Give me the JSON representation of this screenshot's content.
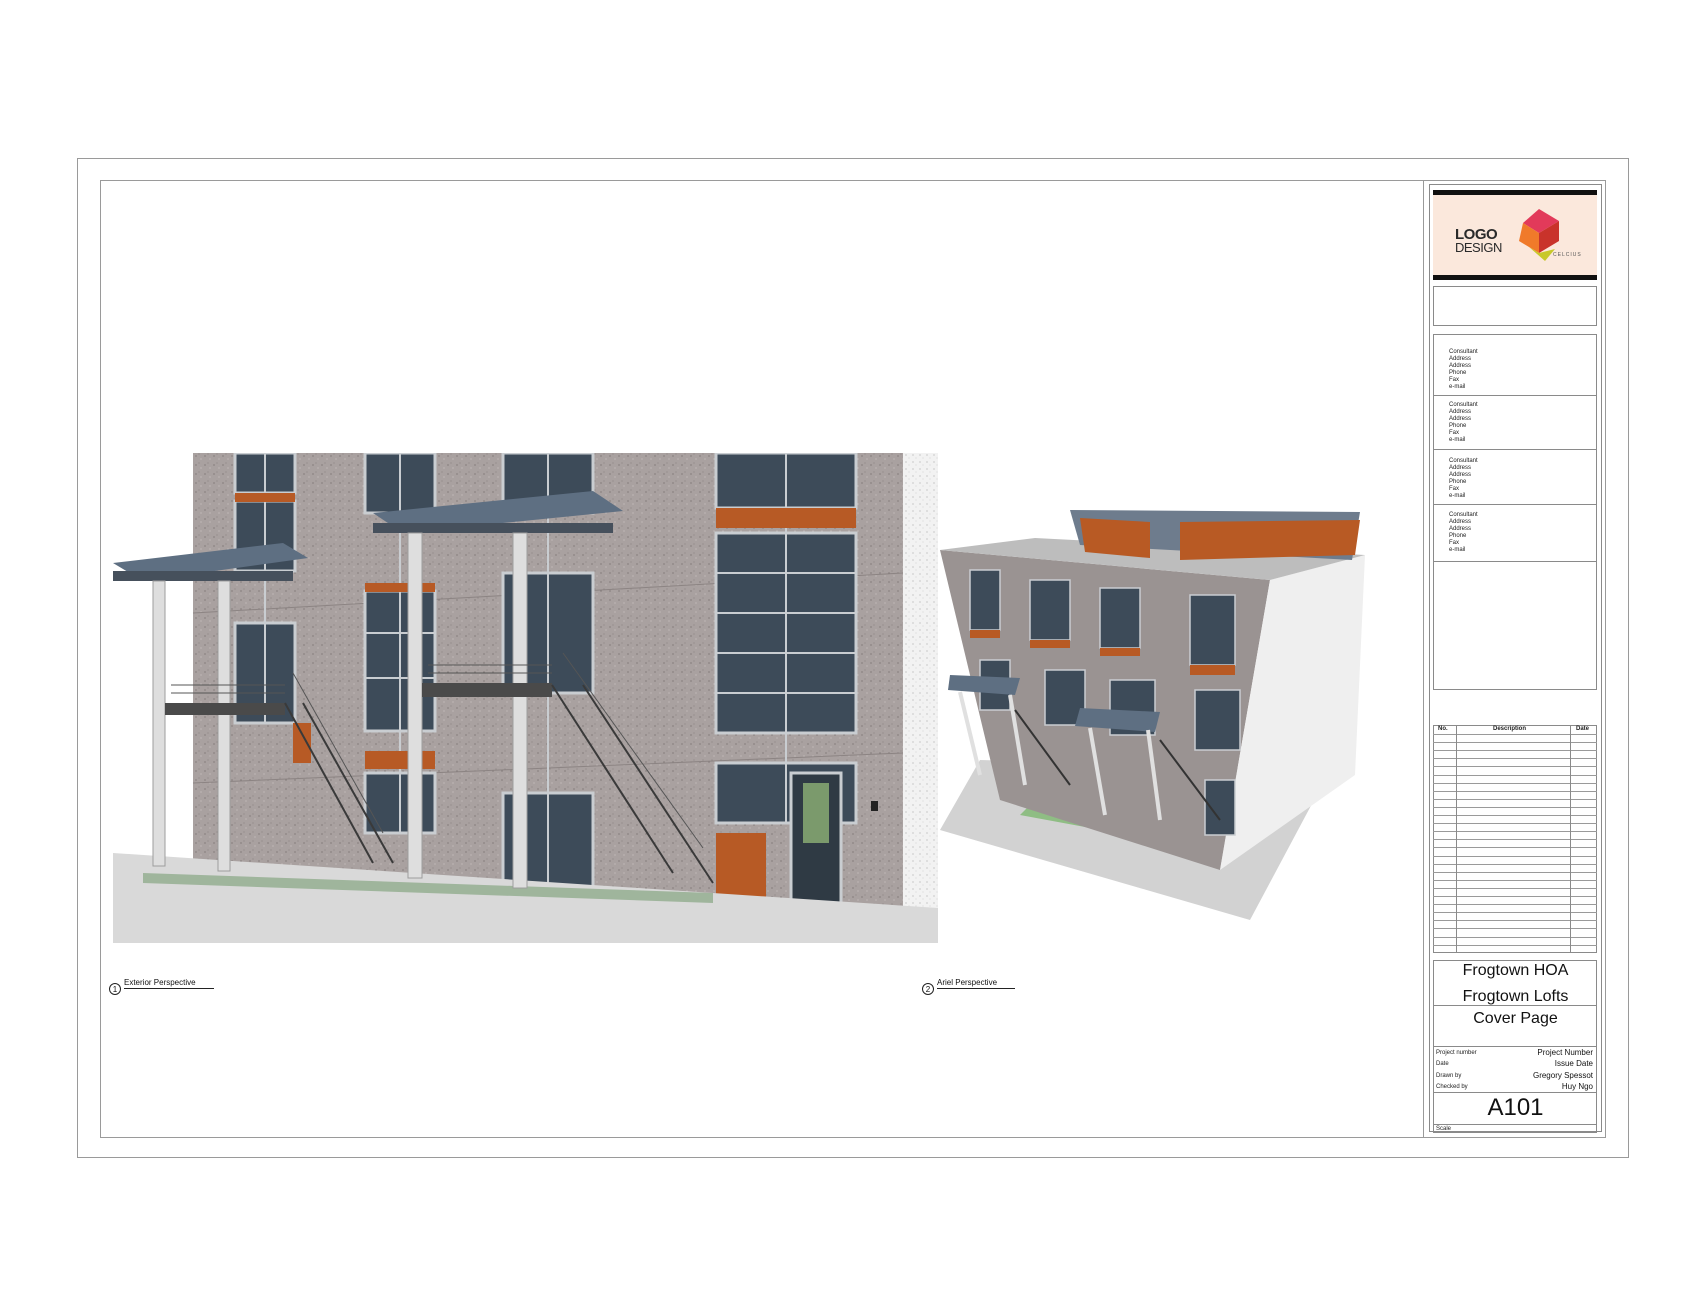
{
  "views": [
    {
      "number": "1",
      "title": "Exterior Perspective"
    },
    {
      "number": "2",
      "title": "Ariel Perspective"
    }
  ],
  "logo": {
    "line1": "LOGO",
    "line2": "DESIGN",
    "brand": "CELCIUS"
  },
  "consultants": [
    {
      "text": "Consultant\nAddress\nAddress\nPhone\nFax\ne-mail"
    },
    {
      "text": "Consultant\nAddress\nAddress\nPhone\nFax\ne-mail"
    },
    {
      "text": "Consultant\nAddress\nAddress\nPhone\nFax\ne-mail"
    },
    {
      "text": "Consultant\nAddress\nAddress\nPhone\nFax\ne-mail"
    }
  ],
  "revisions": {
    "col_no": "No.",
    "col_description": "Description",
    "col_date": "Date"
  },
  "project": {
    "owner": "Frogtown HOA",
    "name": "Frogtown Lofts",
    "sheet_name": "Cover Page"
  },
  "meta": {
    "project_number_label": "Project number",
    "project_number_value": "Project Number",
    "date_label": "Date",
    "date_value": "Issue Date",
    "drawn_by_label": "Drawn by",
    "drawn_by_value": "Gregory Spessot",
    "checked_by_label": "Checked by",
    "checked_by_value": "Huy Ngo"
  },
  "sheet_number": "A101",
  "scale_label": "Scale",
  "colors": {
    "concrete": "#a59d9c",
    "glass": "#3c4a58",
    "wood": "#b85a24",
    "canopy": "#5d6e80",
    "frame": "#d6d6d6"
  }
}
